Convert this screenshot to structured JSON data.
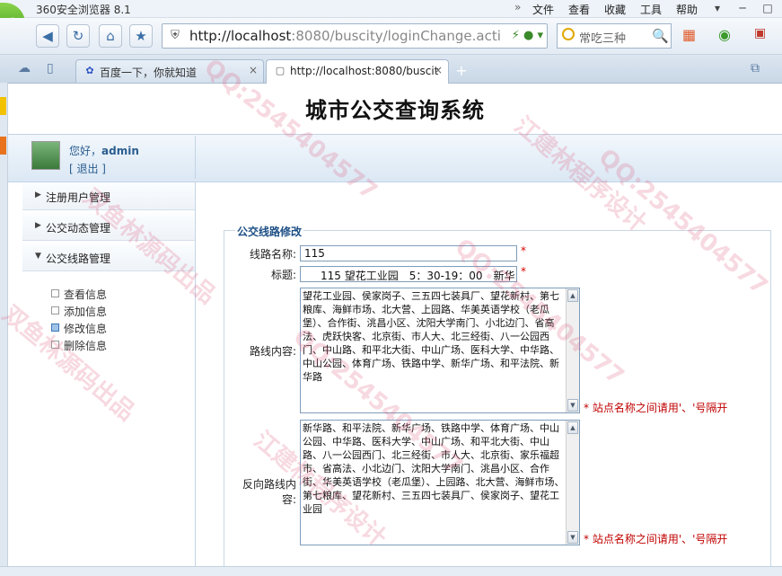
{
  "browser": {
    "app_title": "360安全浏览器 8.1",
    "menu": [
      "文件",
      "查看",
      "收藏",
      "工具",
      "帮助"
    ],
    "url_host": "http://localhost",
    "url_rest": ":8080/buscity/loginChange.acti",
    "search_placeholder": "常吃三种",
    "logo_letter": "e",
    "tabs": [
      {
        "label": "百度一下，你就知道",
        "active": false
      },
      {
        "label": "http://localhost:8080/buscit",
        "active": true
      }
    ]
  },
  "page": {
    "system_title": "城市公交查询系统",
    "user": {
      "greeting_prefix": "您好，",
      "username": "admin",
      "logout_label": "[ 退出 ]"
    },
    "nav": {
      "sections": [
        {
          "label": "注册用户管理",
          "expanded": false
        },
        {
          "label": "公交动态管理",
          "expanded": false
        },
        {
          "label": "公交线路管理",
          "expanded": true
        }
      ],
      "subitems": [
        {
          "label": "查看信息",
          "active": false
        },
        {
          "label": "添加信息",
          "active": false
        },
        {
          "label": "修改信息",
          "active": true
        },
        {
          "label": "删除信息",
          "active": false
        }
      ]
    },
    "form": {
      "panel_title": "公交线路修改",
      "route_name_label": "线路名称:",
      "route_name_value": "115",
      "title_label": "标题:",
      "title_value": "115 望花工业园　5：30-19：00　新华",
      "required_mark": "*",
      "route_content_label": "路线内容:",
      "route_content_value": "望花工业园、侯家岗子、三五四七装具厂、望花新村、第七粮库、海鲜市场、北大营、上园路、华美英语学校（老瓜堡）、合作街、洮昌小区、沈阳大学南门、小北边门、省高法、虎跃快客、北京街、市人大、北三经街、八一公园西门、中山路、和平北大街、中山广场、医科大学、中华路、中山公园、体育广场、铁路中学、新华广场、和平法院、新华路",
      "route_content_hint": "* 站点名称之间请用'、'号隔开",
      "reverse_content_label": "反向路线内容:",
      "reverse_content_value": "新华路、和平法院、新华广场、铁路中学、体育广场、中山公园、中华路、医科大学、中山广场、和平北大街、中山路、八一公园西门、北三经街、市人大、北京街、家乐福超市、省高法、小北边门、沈阳大学南门、洮昌小区、合作街、华美英语学校（老瓜堡）、上园路、北大营、海鲜市场、第七粮库、望花新村、三五四七装具厂、侯家岗子、望花工业园",
      "reverse_content_hint": "* 站点名称之间请用'、'号隔开"
    },
    "watermarks": [
      "QQ:2545404577",
      "双鱼林源码出品",
      "江建林程序设计",
      "QQ:2545404577",
      "双鱼林源码出品",
      "QQ:2545404577",
      "江建林程序设计",
      "QQ:2545404577"
    ]
  }
}
